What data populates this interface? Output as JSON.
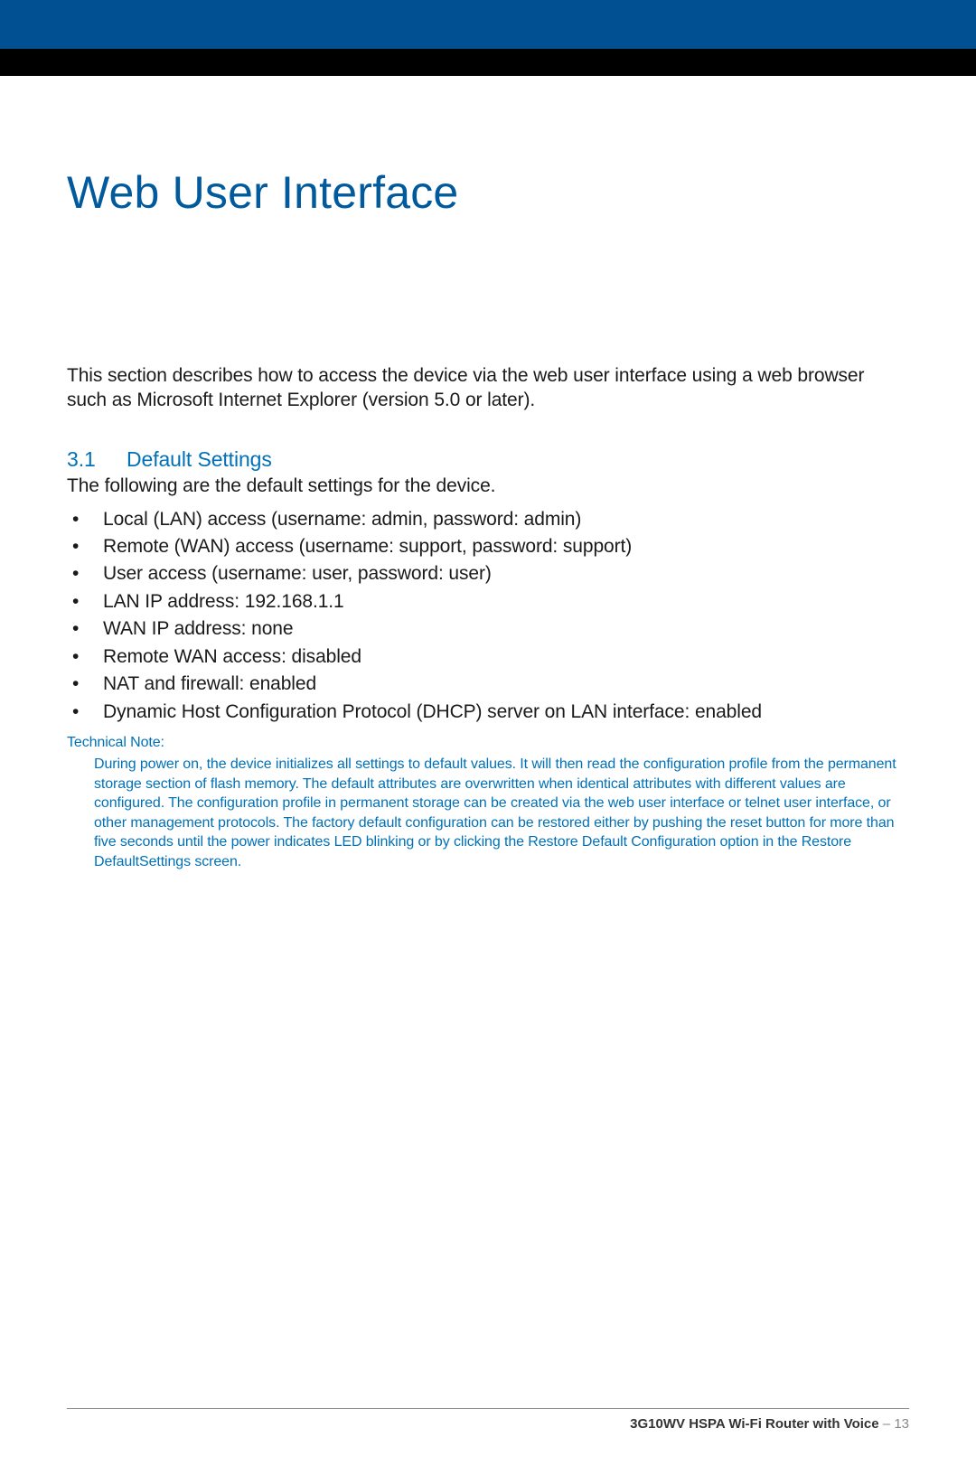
{
  "title": "Web User Interface",
  "intro": "This section describes how to access the device via the web user interface using a web browser such as Microsoft Internet Explorer (version 5.0 or later).",
  "section": {
    "number": "3.1",
    "title": "Default Settings",
    "lead": "The following are the default settings for the device.",
    "items": [
      "Local (LAN) access (username: admin, password: admin)",
      "Remote (WAN) access (username: support, password: support)",
      "User access (username: user, password: user)",
      "LAN IP address: 192.168.1.1",
      "WAN IP address: none",
      "Remote WAN access: disabled",
      "NAT and firewall: enabled",
      "Dynamic Host Configuration Protocol (DHCP) server on LAN interface: enabled"
    ]
  },
  "technical_note": {
    "label": "Technical Note:",
    "body": "During power on, the device initializes all settings to default values. It will then read the configuration profile from the permanent storage section of flash memory. The default attributes are overwritten when identical attributes with different values are configured. The configuration profile in permanent storage can be created via the web user interface or telnet user interface, or other management protocols. The factory default configuration can be restored either by pushing the reset button for more than five seconds until the power indicates LED blinking or by clicking the Restore Default Configuration option in the Restore DefaultSettings screen."
  },
  "footer": {
    "product": "3G10WV HSPA Wi-Fi Router with Voice",
    "separator": " – ",
    "page_number": "13"
  }
}
